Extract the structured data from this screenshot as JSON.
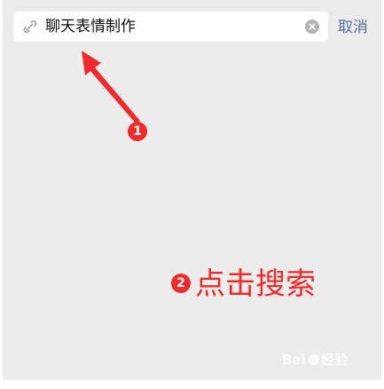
{
  "search": {
    "query": "聊天表情制作"
  },
  "header": {
    "cancel_label": "取消"
  },
  "annotations": {
    "step1_number": "1",
    "step2_number": "2",
    "step2_text": "点击搜索"
  },
  "icons": {
    "search": "link-icon",
    "clear": "clear-icon"
  },
  "colors": {
    "annotation_red": "#ee2a2a",
    "cancel_blue": "#56709c",
    "background": "#ececec"
  }
}
